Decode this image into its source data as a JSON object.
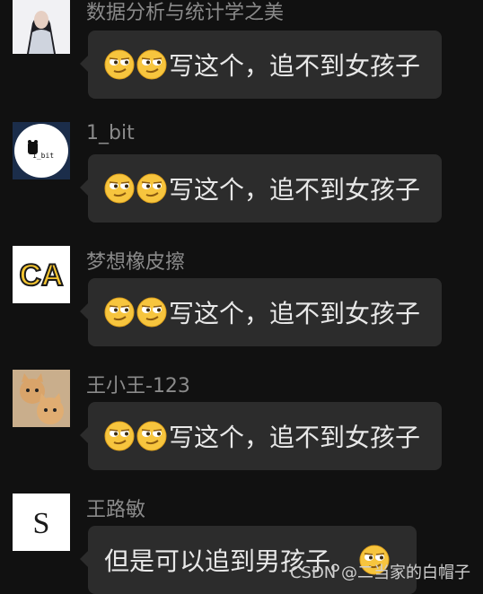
{
  "messages": [
    {
      "sender": "数据分析与统计学之美",
      "text": "写这个，追不到女孩子",
      "emojis": [
        "smirk-face",
        "smirk-face"
      ]
    },
    {
      "sender": "1_bit",
      "avatar_text": "1_bit",
      "text": "写这个，追不到女孩子",
      "emojis": [
        "smirk-face",
        "smirk-face"
      ]
    },
    {
      "sender": "梦想橡皮擦",
      "avatar_text": "CA",
      "text": "写这个，追不到女孩子",
      "emojis": [
        "smirk-face",
        "smirk-face"
      ]
    },
    {
      "sender": "王小王-123",
      "text": "写这个，追不到女孩子",
      "emojis": [
        "smirk-face",
        "smirk-face"
      ]
    },
    {
      "sender": "王路敏",
      "avatar_text": "S",
      "text": "但是可以追到男孩子。",
      "emojis": [
        "smirk-face"
      ]
    }
  ],
  "watermark": "CSDN @二当家的白帽子",
  "colors": {
    "background": "#111111",
    "bubble": "#2c2c2c",
    "sender_text": "#8a8a8a",
    "message_text": "#e8e8e8"
  }
}
